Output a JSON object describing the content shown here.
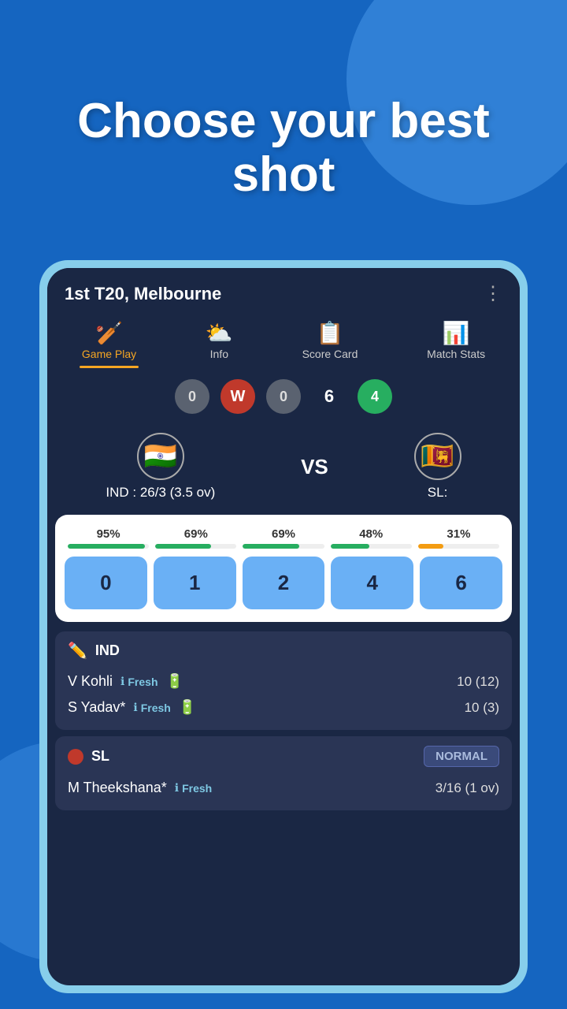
{
  "background": {
    "color": "#1565c0"
  },
  "hero": {
    "line1": "Choose your best",
    "line2": "shot"
  },
  "phone": {
    "header": {
      "title": "1st T20, Melbourne",
      "menu_icon": "⋮"
    },
    "nav_tabs": [
      {
        "id": "game-play",
        "icon": "🏏",
        "label": "Game Play",
        "active": true
      },
      {
        "id": "info",
        "icon": "⛅",
        "label": "Info",
        "active": false
      },
      {
        "id": "score-card",
        "icon": "📋",
        "label": "Score Card",
        "active": false
      },
      {
        "id": "match-stats",
        "icon": "📊",
        "label": "Match Stats",
        "active": false
      }
    ],
    "score_balls": [
      {
        "type": "gray",
        "value": "0"
      },
      {
        "type": "wicket",
        "value": "W"
      },
      {
        "type": "gray",
        "value": "0"
      },
      {
        "type": "plain",
        "value": "6"
      },
      {
        "type": "green",
        "value": "4"
      }
    ],
    "teams": {
      "team1": {
        "flag": "🇮🇳",
        "name": "IND",
        "score": "IND : 26/3 (3.5 ov)"
      },
      "vs": "VS",
      "team2": {
        "flag": "🇱🇰",
        "name": "SL",
        "score": "SL:"
      }
    },
    "shot_card": {
      "shots": [
        {
          "label": "0",
          "percentage": "95%",
          "bar_color": "green",
          "bar_value": 95
        },
        {
          "label": "1",
          "percentage": "69%",
          "bar_color": "green",
          "bar_value": 69
        },
        {
          "label": "2",
          "percentage": "69%",
          "bar_color": "green",
          "bar_value": 69
        },
        {
          "label": "4",
          "percentage": "48%",
          "bar_color": "green",
          "bar_value": 48
        },
        {
          "label": "6",
          "percentage": "31%",
          "bar_color": "orange",
          "bar_value": 31
        }
      ]
    },
    "batting_team": {
      "icon": "✏️",
      "name": "IND",
      "players": [
        {
          "name": "V Kohli",
          "fresh": true,
          "fresh_label": "Fresh",
          "battery": true,
          "score": "10 (12)"
        },
        {
          "name": "S Yadav*",
          "fresh": true,
          "fresh_label": "Fresh",
          "battery": true,
          "score": "10 (3)"
        }
      ]
    },
    "bowling_team": {
      "name": "SL",
      "mode": "NORMAL",
      "bowlers": [
        {
          "name": "M Theekshana*",
          "fresh": true,
          "fresh_label": "Fresh",
          "score": "3/16 (1 ov)"
        }
      ]
    }
  }
}
